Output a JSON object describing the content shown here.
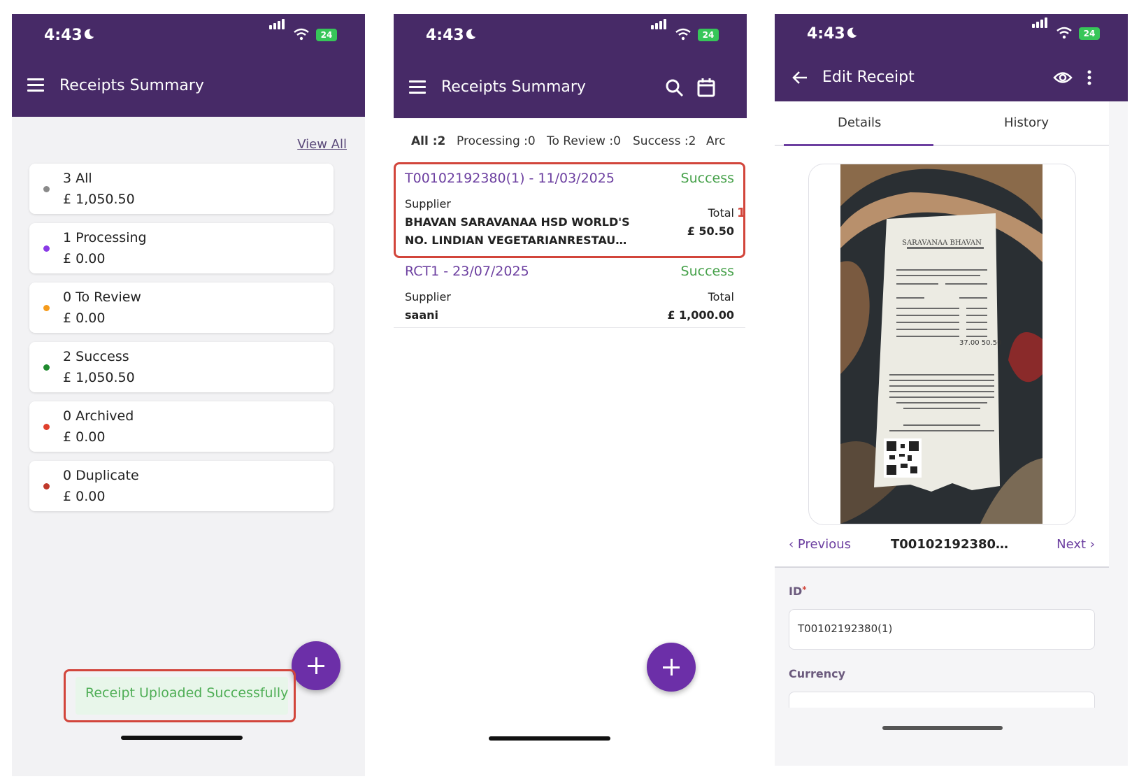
{
  "screens": {
    "summary": {
      "status_time": "4:43",
      "battery": "24",
      "title": "Receipts Summary",
      "view_all": "View All",
      "cards": [
        {
          "label": "3 All",
          "amount": "£ 1,050.50",
          "dot_color": "#8a8a8a"
        },
        {
          "label": "1 Processing",
          "amount": "£ 0.00",
          "dot_color": "#8a3ae6"
        },
        {
          "label": "0 To Review",
          "amount": "£ 0.00",
          "dot_color": "#f59b1c"
        },
        {
          "label": "2 Success",
          "amount": "£ 1,050.50",
          "dot_color": "#1f8a2e"
        },
        {
          "label": "0 Archived",
          "amount": "£ 0.00",
          "dot_color": "#e0402c"
        },
        {
          "label": "0 Duplicate",
          "amount": "£ 0.00",
          "dot_color": "#c0392b"
        }
      ],
      "toast": "Receipt Uploaded Successfully"
    },
    "list": {
      "status_time": "4:43",
      "battery": "24",
      "title": "Receipts Summary",
      "tabs": [
        "All :2",
        "Processing :0",
        "To Review :0",
        "Success :2",
        "Arc"
      ],
      "annotation": "1",
      "receipts": [
        {
          "title": "T00102192380(1) - 11/03/2025",
          "status": "Success",
          "supplier_label": "Supplier",
          "supplier_line1": "BHAVAN SARAVANAA HSD WORLD'S",
          "supplier_line2": "NO. LINDIAN VEGETARIANRESTAU…",
          "total_label": "Total",
          "total": "£ 50.50"
        },
        {
          "title": "RCT1 - 23/07/2025",
          "status": "Success",
          "supplier_label": "Supplier",
          "supplier_line1": "saani",
          "total_label": "Total",
          "total": "£ 1,000.00"
        }
      ]
    },
    "edit": {
      "status_time": "4:43",
      "battery": "24",
      "title": "Edit Receipt",
      "tabs": [
        "Details",
        "History"
      ],
      "receipt_header": "SARAVANAA BHAVAN",
      "receipt_total": "37.00  50.50",
      "previous": "Previous",
      "record_id_short": "T00102192380…",
      "next": "Next",
      "id_label": "ID",
      "id_required": "*",
      "id_value": "T00102192380(1)",
      "currency_label": "Currency"
    }
  },
  "colors": {
    "brand": "#472a67",
    "accent": "#6c2fa8",
    "success": "#46a14a",
    "annotation": "#d2453b"
  }
}
